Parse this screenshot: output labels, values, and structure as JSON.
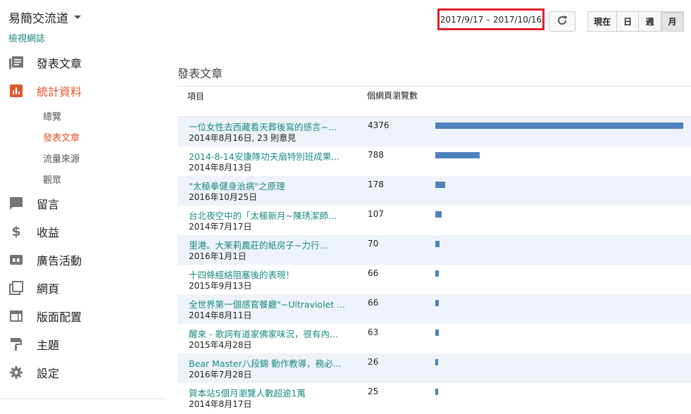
{
  "blog": {
    "title": "易簡交流道",
    "view_blog_link": "檢視網誌"
  },
  "nav": {
    "items": [
      {
        "label": "發表文章",
        "icon": "posts-icon"
      },
      {
        "label": "統計資料",
        "icon": "stats-icon",
        "active": true
      },
      {
        "label": "留言",
        "icon": "comments-icon"
      },
      {
        "label": "收益",
        "icon": "dollar-icon"
      },
      {
        "label": "廣告活動",
        "icon": "ad-campaign-icon"
      },
      {
        "label": "網頁",
        "icon": "pages-icon"
      },
      {
        "label": "版面配置",
        "icon": "layout-icon"
      },
      {
        "label": "主題",
        "icon": "theme-icon"
      },
      {
        "label": "設定",
        "icon": "settings-gear-icon"
      }
    ],
    "stats_sub": [
      {
        "label": "總覽"
      },
      {
        "label": "發表文章",
        "active": true
      },
      {
        "label": "流量來源"
      },
      {
        "label": "觀眾"
      }
    ]
  },
  "toolbar": {
    "date_range": "2017/9/17 – 2017/10/16",
    "periods": [
      "現在",
      "日",
      "週",
      "月"
    ],
    "selected_period": "月"
  },
  "section": {
    "title": "發表文章"
  },
  "table": {
    "header_item": "項目",
    "header_views": "個網頁瀏覽數",
    "max_views": 4376,
    "rows": [
      {
        "title": "一位女性去西藏看天葬後寫的感言~...",
        "date": "2014年8月16日, 23 則意見",
        "views": 4376
      },
      {
        "title": "2014-8-14安康隊功夫扇特別班成果...",
        "date": "2014年8月13日",
        "views": 788
      },
      {
        "title": "\"太極拳健身治病\"之原理",
        "date": "2016年10月25日",
        "views": 178
      },
      {
        "title": "台北夜空中的「太極新月~陳琇潔師...",
        "date": "2014年7月17日",
        "views": 107
      },
      {
        "title": "里港。大茉莉農莊的紙房子~力行...",
        "date": "2016年1月1日",
        "views": 70
      },
      {
        "title": "十四條經絡阻塞後的表現！",
        "date": "2015年9月13日",
        "views": 66
      },
      {
        "title": "全世界第一個感官餐廳\"~Ultraviolet ...",
        "date": "2014年8月11日",
        "views": 66
      },
      {
        "title": "醒來 - 歌詞有道家佛家味況，很有內...",
        "date": "2015年4月28日",
        "views": 63
      },
      {
        "title": "Bear Master八段錦 動作教導，務必...",
        "date": "2016年7月28日",
        "views": 26
      },
      {
        "title": "賀本站5個月瀏覽人數超逾1萬",
        "date": "2014年8月17日",
        "views": 25
      }
    ]
  },
  "colors": {
    "accent": "#e2542a",
    "link": "#1a8a80",
    "bar": "#4f81bd",
    "highlight_border": "#e0202a"
  }
}
